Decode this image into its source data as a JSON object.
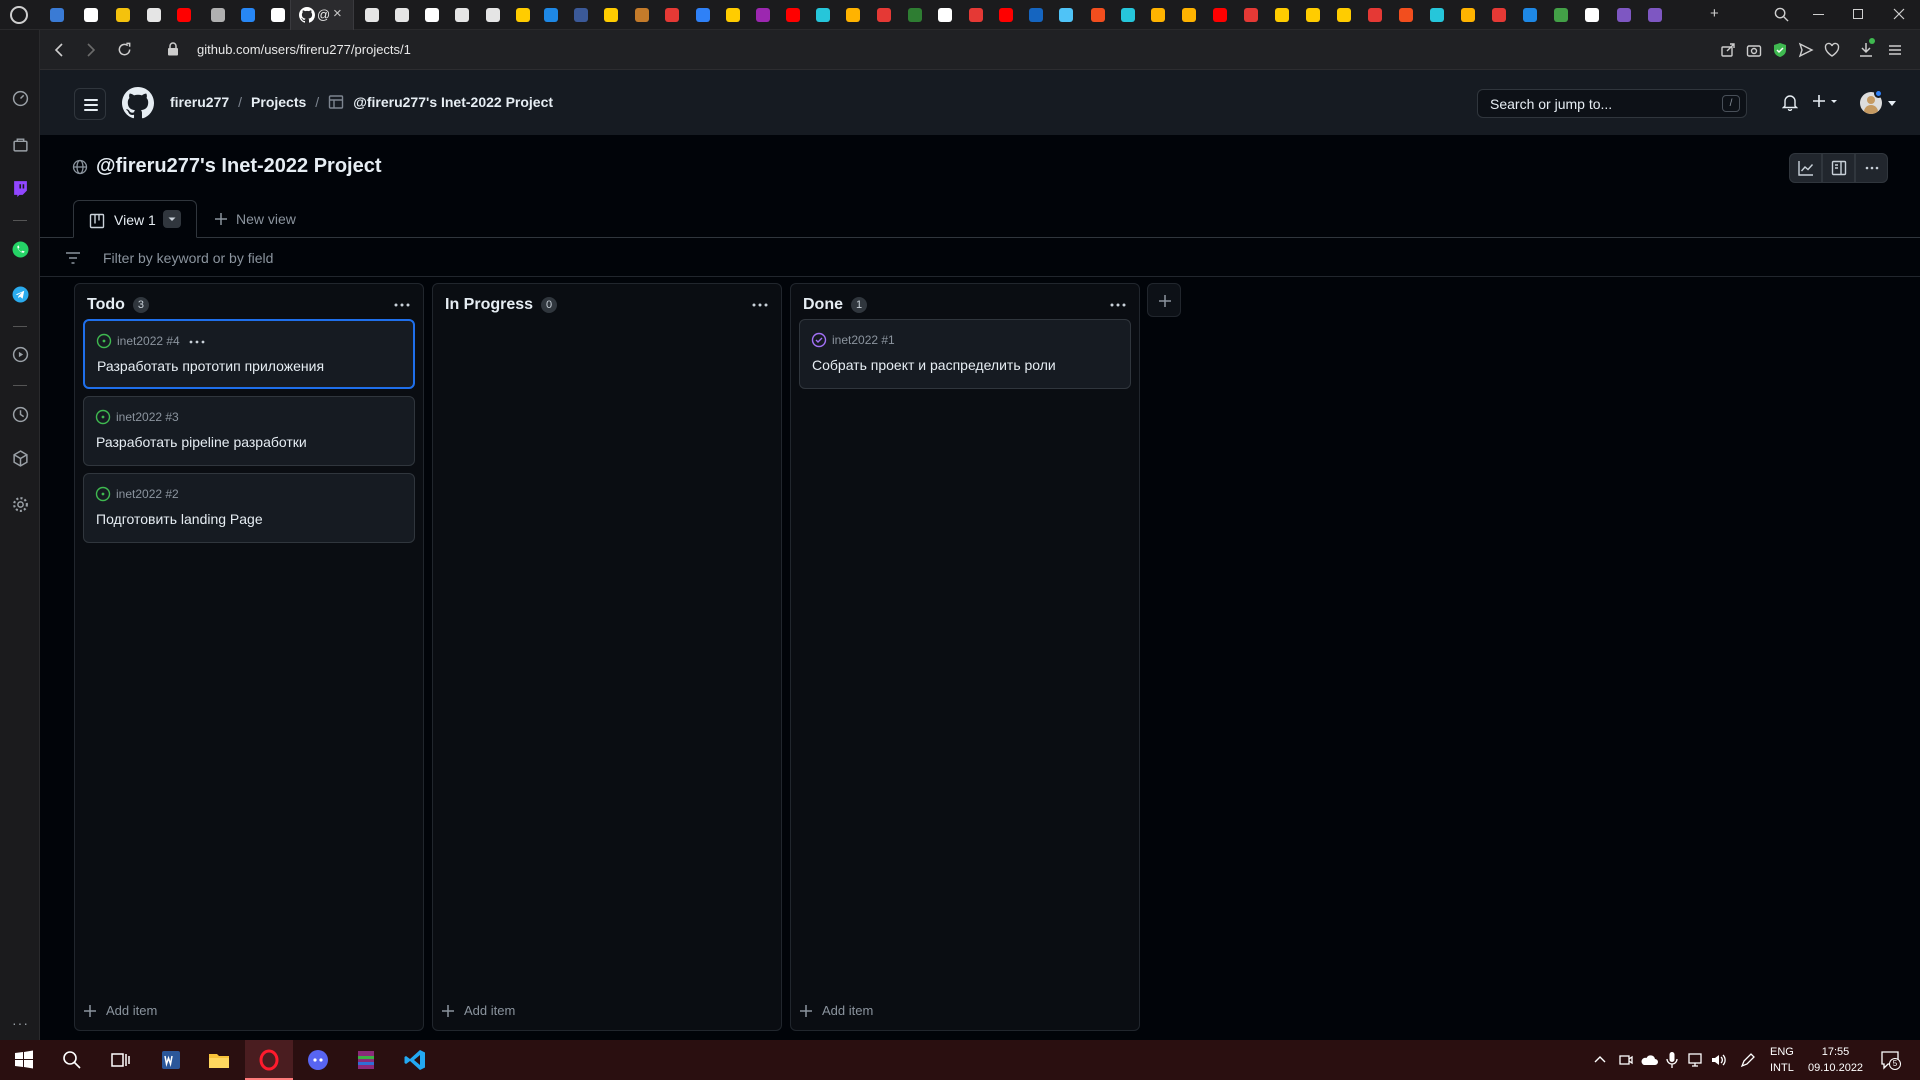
{
  "browser": {
    "active_tab": {
      "label": "@",
      "favicon": "github-icon",
      "close": "×"
    },
    "url": "github.com/users/fireru277/projects/1",
    "new_tab": "+"
  },
  "header": {
    "breadcrumbs": [
      "fireru277",
      "Projects",
      "@fireru277's Inet-2022 Project"
    ],
    "search_placeholder": "Search or jump to...",
    "search_shortcut": "/"
  },
  "project": {
    "title": "@fireru277's Inet-2022 Project",
    "views": [
      {
        "label": "View 1"
      }
    ],
    "new_view_label": "New view",
    "filter_placeholder": "Filter by keyword or by field"
  },
  "board": {
    "columns": [
      {
        "name": "Todo",
        "count": "3",
        "add_label": "Add item",
        "cards": [
          {
            "ref": "inet2022 #4",
            "title": "Разработать прототип приложения",
            "status": "open",
            "selected": true
          },
          {
            "ref": "inet2022 #3",
            "title": "Разработать pipeline разработки",
            "status": "open"
          },
          {
            "ref": "inet2022 #2",
            "title": "Подготовить landing Page",
            "status": "open"
          }
        ]
      },
      {
        "name": "In Progress",
        "count": "0",
        "add_label": "Add item",
        "cards": []
      },
      {
        "name": "Done",
        "count": "1",
        "add_label": "Add item",
        "cards": [
          {
            "ref": "inet2022 #1",
            "title": "Собрать проект и распределить роли",
            "status": "closed"
          }
        ]
      }
    ]
  },
  "taskbar": {
    "language": "ENG",
    "layout": "INTL",
    "time": "17:55",
    "date": "09.10.2022",
    "notifications": "5"
  },
  "colors": {
    "open": "#3fb950",
    "closed": "#a371f7",
    "accent": "#1f6feb"
  }
}
